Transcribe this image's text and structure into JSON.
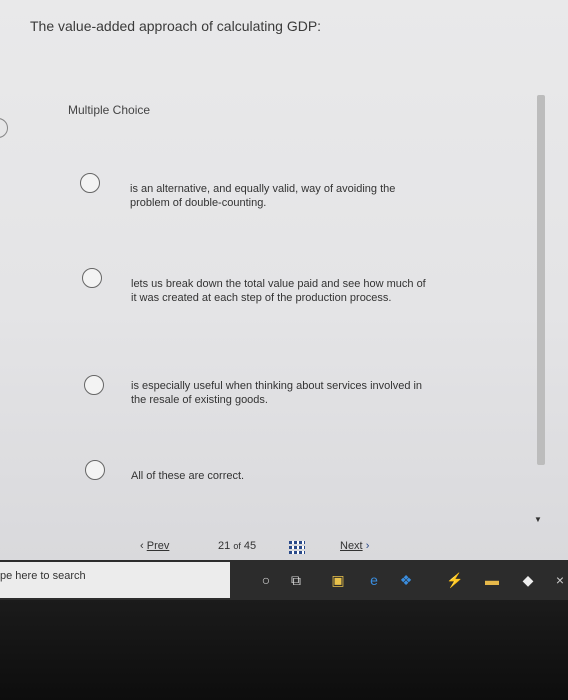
{
  "question": "The value-added approach of calculating GDP:",
  "question_type": "Multiple Choice",
  "options": [
    {
      "text": "is an alternative, and equally valid, way of avoiding the problem of double-counting."
    },
    {
      "text": "lets us break down the total value paid and see how much of it was created at each step of the production process."
    },
    {
      "text": "is especially useful when thinking about services involved in the resale of existing goods."
    },
    {
      "text": "All of these are correct."
    }
  ],
  "pager": {
    "prev_label": "Prev",
    "page_current": "21",
    "page_of": "of",
    "page_total": "45",
    "next_label": "Next"
  },
  "taskbar": {
    "search_placeholder": "pe here to search"
  }
}
